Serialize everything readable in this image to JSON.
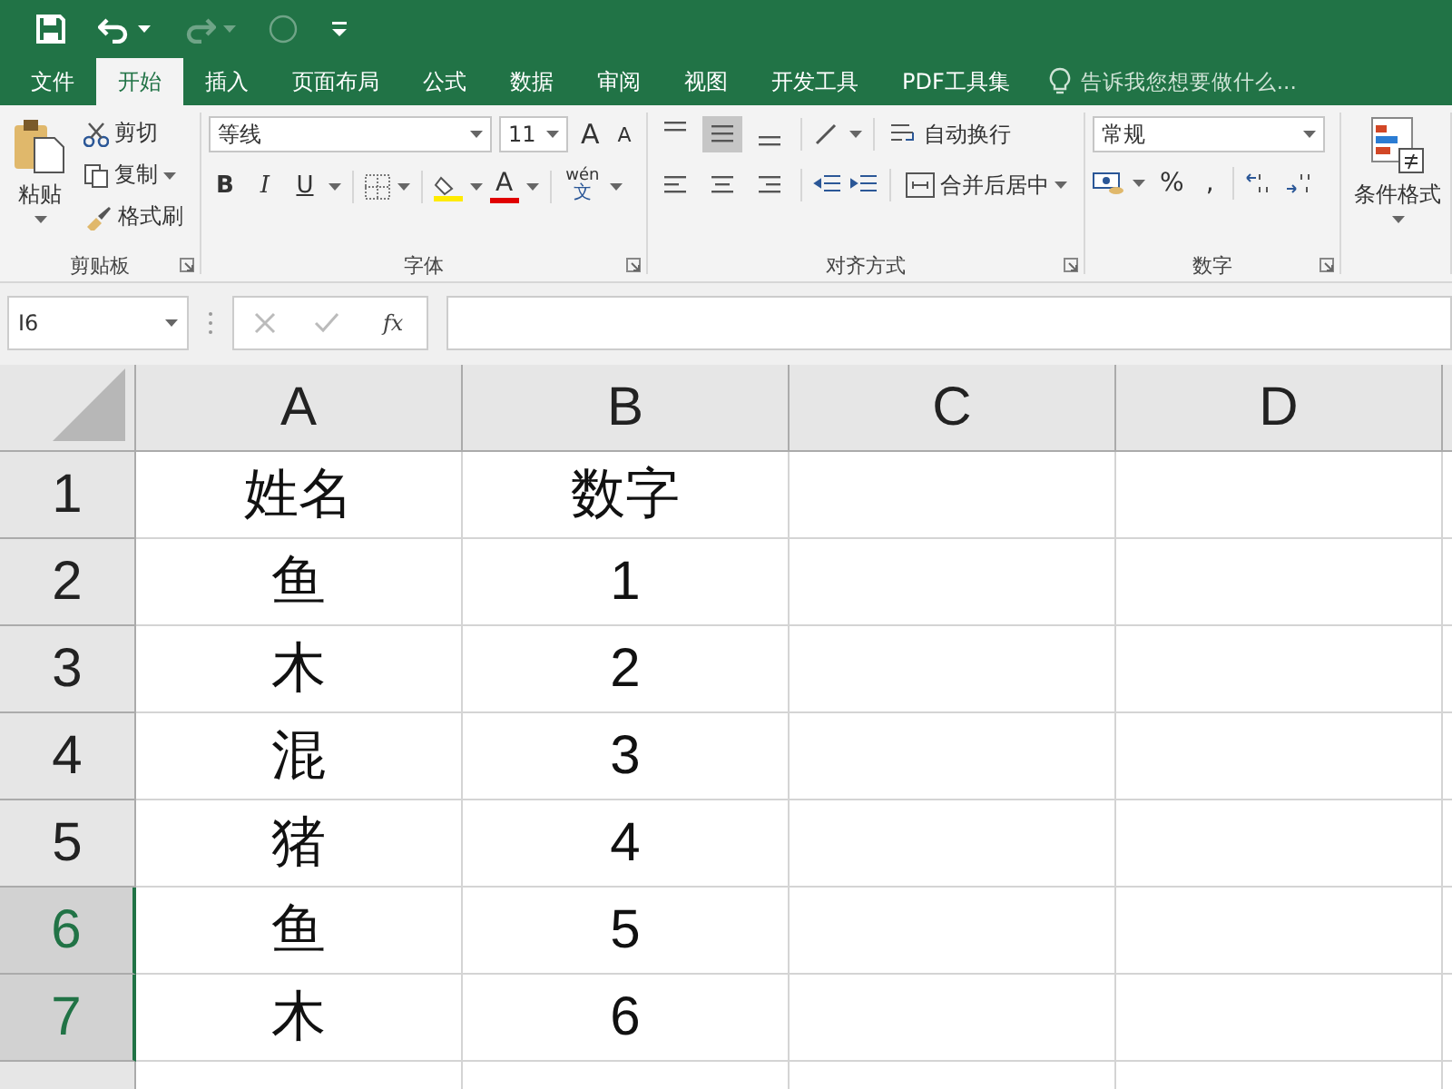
{
  "quick_access": [
    {
      "kind": "save",
      "disabled": false
    },
    {
      "kind": "undo",
      "disabled": false
    },
    {
      "kind": "redo",
      "disabled": true
    },
    {
      "kind": "touch",
      "disabled": true
    },
    {
      "kind": "customize",
      "disabled": false
    }
  ],
  "tabs": [
    {
      "label": "文件",
      "selected": false
    },
    {
      "label": "开始",
      "selected": true
    },
    {
      "label": "插入",
      "selected": false
    },
    {
      "label": "页面布局",
      "selected": false
    },
    {
      "label": "公式",
      "selected": false
    },
    {
      "label": "数据",
      "selected": false
    },
    {
      "label": "审阅",
      "selected": false
    },
    {
      "label": "视图",
      "selected": false
    },
    {
      "label": "开发工具",
      "selected": false
    },
    {
      "label": "PDF工具集",
      "selected": false
    }
  ],
  "tell_me": "告诉我您想要做什么...",
  "ribbon": {
    "clipboard": {
      "paste": "粘贴",
      "cut": "剪切",
      "copy": "复制",
      "format_painter": "格式刷",
      "label": "剪贴板"
    },
    "font": {
      "font_name": "等线",
      "font_size": "11",
      "grow": "A",
      "shrink": "A",
      "bold": "B",
      "italic": "I",
      "underline": "U",
      "font_color": "A",
      "phonetic_top": "wén",
      "phonetic_bottom": "文",
      "label": "字体"
    },
    "alignment": {
      "vertical": [
        {
          "kind": "top",
          "selected": false
        },
        {
          "kind": "middle",
          "selected": true
        },
        {
          "kind": "bottom",
          "selected": false
        }
      ],
      "wrap_text": "自动换行",
      "merge_center": "合并后居中",
      "label": "对齐方式"
    },
    "number": {
      "format": "常规",
      "percent": "%",
      "comma": ",",
      "label": "数字"
    },
    "styles": {
      "conditional_formatting": "条件格式"
    }
  },
  "formula_bar": {
    "name_box": "I6",
    "function": "fx"
  },
  "sheet": {
    "columns": [
      "A",
      "B",
      "C",
      "D"
    ],
    "rows": [
      {
        "number": "1",
        "selected": false,
        "cells": [
          "姓名",
          "数字"
        ]
      },
      {
        "number": "2",
        "selected": false,
        "cells": [
          "鱼",
          "1"
        ]
      },
      {
        "number": "3",
        "selected": false,
        "cells": [
          "木",
          "2"
        ]
      },
      {
        "number": "4",
        "selected": false,
        "cells": [
          "混",
          "3"
        ]
      },
      {
        "number": "5",
        "selected": false,
        "cells": [
          "猪",
          "4"
        ]
      },
      {
        "number": "6",
        "selected": true,
        "cells": [
          "鱼",
          "5"
        ]
      },
      {
        "number": "7",
        "selected": true,
        "cells": [
          "木",
          "6"
        ]
      }
    ]
  }
}
